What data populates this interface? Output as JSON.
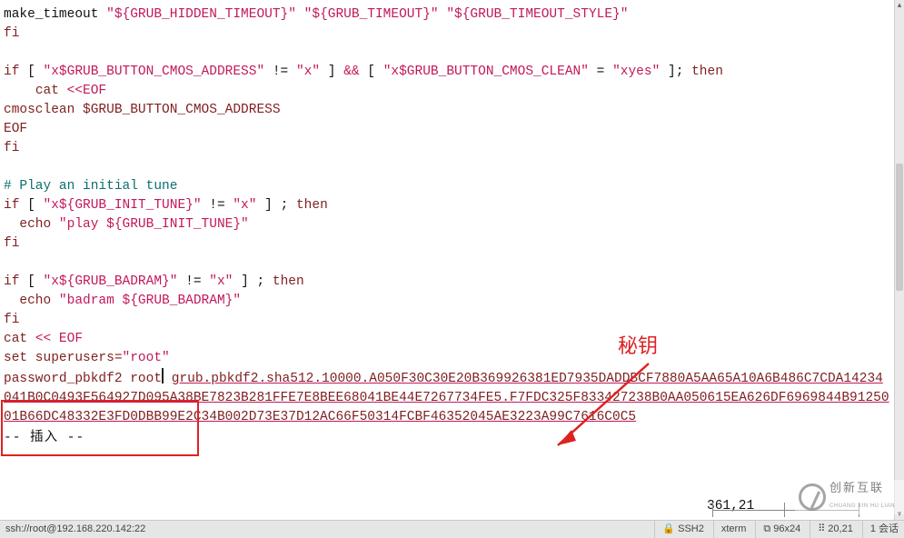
{
  "code": {
    "make_timeout_call": "make_timeout ",
    "arg1": "\"${GRUB_HIDDEN_TIMEOUT}\"",
    "arg2": "\"${GRUB_TIMEOUT}\"",
    "arg3": "\"${GRUB_TIMEOUT_STYLE}\"",
    "fi": "fi",
    "if_open": "if",
    "lbrack": "[",
    "rbrack": "]",
    "cmos_lhs": "\"x$GRUB_BUTTON_CMOS_ADDRESS\"",
    "neq": "!=",
    "x": "\"x\"",
    "andand": "&&",
    "cmos_clean_lhs": "\"x$GRUB_BUTTON_CMOS_CLEAN\"",
    "eq": "=",
    "xyes": "\"xyes\"",
    "semicolon": ";",
    "then": "then",
    "cat_word": "cat",
    "heredoc_start": "<<EOF",
    "cmosclean": "cmosclean $GRUB_BUTTON_CMOS_ADDRESS",
    "eof": "EOF",
    "comment_tune": "# Play an initial tune",
    "init_tune_lhs": "\"x${GRUB_INIT_TUNE}\"",
    "echo_word": "echo",
    "play_str": "\"play ${GRUB_INIT_TUNE}\"",
    "badram_lhs": "\"x${GRUB_BADRAM}\"",
    "badram_str": "\"badram ${GRUB_BADRAM}\"",
    "cat_heredoc2": "<< EOF",
    "set_superusers": "set superusers=",
    "root_q": "\"root\"",
    "pw_pbkdf2": "password_pbkdf2 root",
    "pbkdf2_hash": "grub.pbkdf2.sha512.10000.A050F30C30E20B369926381ED7935DADDBCF7880A5AA65A10A6B486C7CDA14234041B0C0493F564927D095A38BE7823B281FFE7E8BEE68041BE44E7267734FE5.F7FDC325F833427238B0AA050615EA626DF6969844B9125001B66DC48332E3FD0DBB99E2C34B002D73E37D12AC66F50314FCBF46352045AE3223A99C7616C0C5",
    "mode_text": "-- 插入 --",
    "cursor_pos": "361,21"
  },
  "annotation": {
    "secret_label": "秘钥"
  },
  "statusbar": {
    "ssh_target": "ssh://root@192.168.220.142:22",
    "proto": "SSH2",
    "term": "xterm",
    "size": "96x24",
    "pos": "20,21",
    "sess": "1 会话"
  },
  "watermark": {
    "cn": "创新互联",
    "en": "CHUANG XIN HU LIAN"
  }
}
